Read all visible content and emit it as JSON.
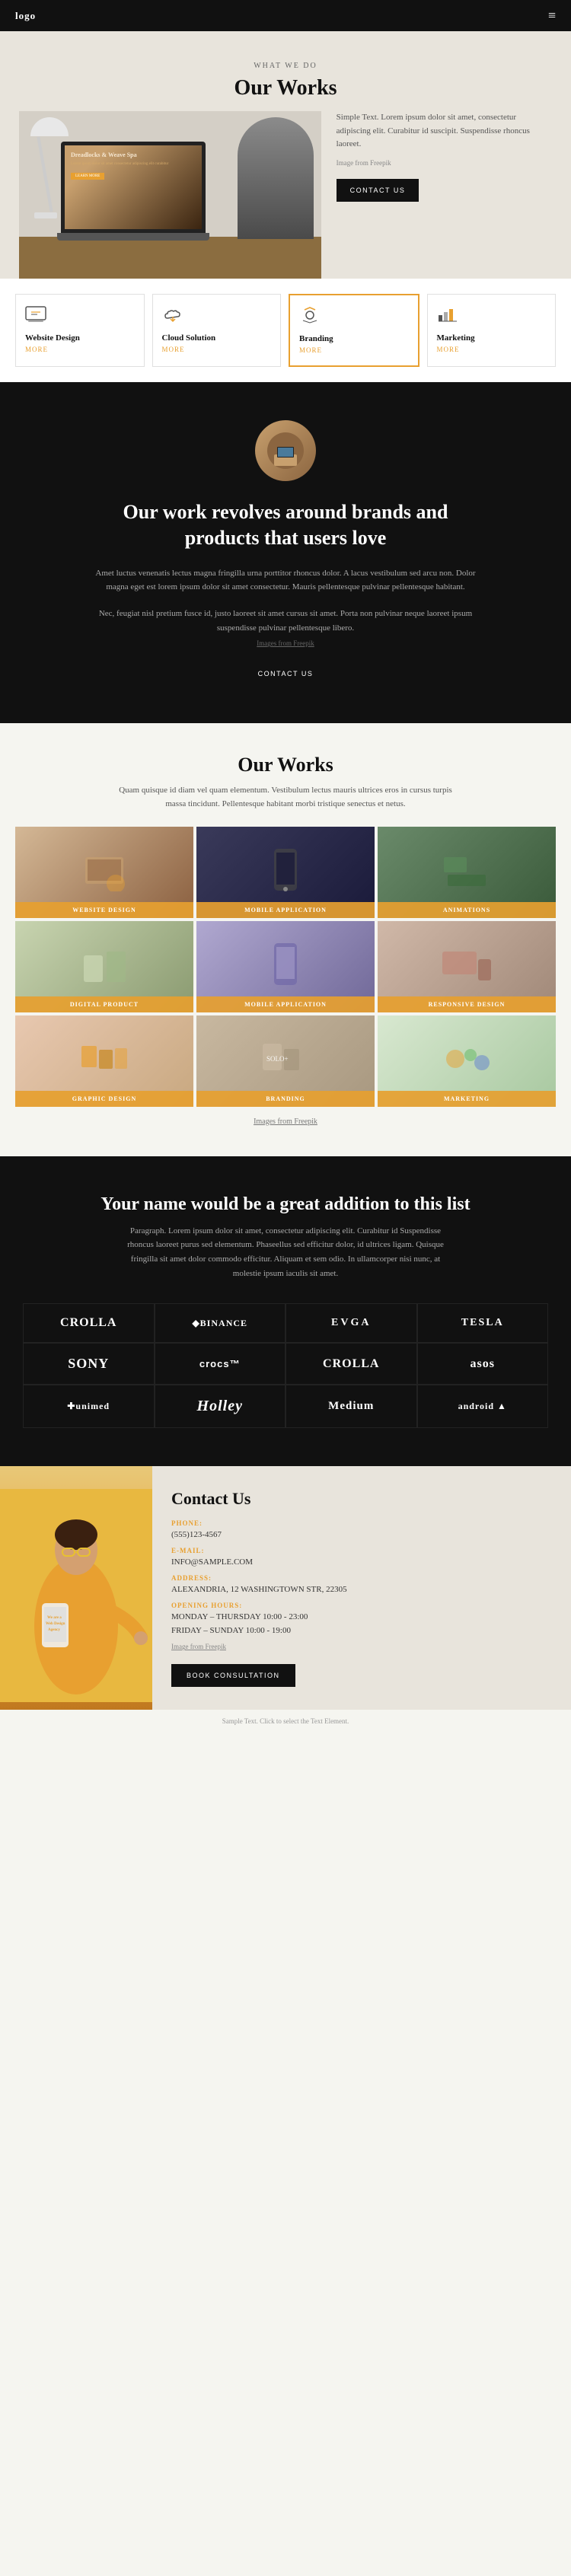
{
  "nav": {
    "logo": "logo",
    "hamburger": "≡"
  },
  "hero": {
    "what_we_do": "WHAT WE DO",
    "title": "Our Works",
    "description": "Simple Text. Lorem ipsum dolor sit amet, consectetur adipiscing elit. Curabitur id suscipit. Suspendisse rhoncus laoreet.",
    "image_credit": "Image from Freepik",
    "contact_button": "CONTACT US",
    "laptop_title": "Dreadlocks & Weave Spa",
    "laptop_sub": "Lorem ipsum dolor sit amet consectetur adipiscing elit curabitur",
    "laptop_btn": "LEARN MORE"
  },
  "services": [
    {
      "icon": "⬜",
      "title": "Website Design",
      "more": "MORE"
    },
    {
      "icon": "☁",
      "title": "Cloud Solution",
      "more": "MORE"
    },
    {
      "icon": "📢",
      "title": "Branding",
      "more": "MORE",
      "highlight": true
    },
    {
      "icon": "📊",
      "title": "Marketing",
      "more": "MORE"
    }
  ],
  "brand_section": {
    "title": "Our work revolves around brands and products that users love",
    "description": "Amet luctus venenatis lectus magna fringilla urna porttitor rhoncus dolor. A lacus vestibulum sed arcu non. Dolor magna eget est lorem ipsum dolor sit amet consectetur. Mauris pellentesque pulvinar pellentesque habitant.",
    "description2": "Nec, feugiat nisl pretium fusce id, justo laoreet sit amet cursus sit amet. Porta non pulvinar neque laoreet ipsum suspendisse pulvinar pellentesque libero.",
    "image_credit": "Images from Freepik",
    "contact_button": "CONTACT US"
  },
  "portfolio": {
    "title": "Our Works",
    "description": "Quam quisque id diam vel quam elementum. Vestibulum lectus mauris ultrices eros in cursus turpis massa tincidunt. Pellentesque habitant morbi tristique senectus et netus.",
    "items": [
      {
        "label": "WEBSITE DESIGN",
        "bg": "port-bg-1"
      },
      {
        "label": "MOBILE APPLICATION",
        "bg": "port-bg-2"
      },
      {
        "label": "ANIMATIONS",
        "bg": "port-bg-3"
      },
      {
        "label": "DIGITAL PRODUCT",
        "bg": "port-bg-4"
      },
      {
        "label": "MOBILE APPLICATION",
        "bg": "port-bg-5"
      },
      {
        "label": "RESPONSIVE DESIGN",
        "bg": "port-bg-6"
      },
      {
        "label": "GRAPHIC DESIGN",
        "bg": "port-bg-7"
      },
      {
        "label": "BRANDING",
        "bg": "port-bg-8"
      },
      {
        "label": "MARKETING",
        "bg": "port-bg-9"
      }
    ],
    "image_credit": "Images from Freepik"
  },
  "clients": {
    "title": "Your name would be a great addition to this list",
    "description": "Paragraph. Lorem ipsum dolor sit amet, consectetur adipiscing elit. Curabitur id Suspendisse rhoncus laoreet purus sed elementum. Phaseellus sed efficitur dolor, id ultrices ligam. Quisque fringilla sit amet dolor commodo efficitur. Aliquam et sem odio. In ullamcorper nisi nunc, at molestie ipsum iaculis sit amet.",
    "logos": [
      {
        "text": "CROLLA",
        "class": "logo-crolla"
      },
      {
        "text": "◆BINANCE",
        "class": "logo-binance"
      },
      {
        "text": "EVGA",
        "class": "logo-evga"
      },
      {
        "text": "TESLA",
        "class": "logo-tesla"
      },
      {
        "text": "SONY",
        "class": "logo-sony"
      },
      {
        "text": "crocs™",
        "class": "logo-crocs"
      },
      {
        "text": "CROLLA",
        "class": "logo-crolla2"
      },
      {
        "text": "asos",
        "class": "logo-asos"
      },
      {
        "text": "✚unimed",
        "class": "logo-unimed"
      },
      {
        "text": "Holley",
        "class": "logo-holley"
      },
      {
        "text": "Medium",
        "class": "logo-medium"
      },
      {
        "text": "android ▲",
        "class": "logo-android"
      }
    ]
  },
  "contact": {
    "title": "Contact Us",
    "phone_label": "PHONE:",
    "phone_value": "(555)123-4567",
    "email_label": "E-MAIL:",
    "email_value": "INFO@SAMPLE.COM",
    "address_label": "ADDRESS:",
    "address_value": "ALEXANDRIA, 12 WASHINGTOWN STR, 22305",
    "hours_label": "OPENING HOURS:",
    "hours_mon_thu": "MONDAY – THURSDAY 10:00 - 23:00",
    "hours_fri_sun": "FRIDAY – SUNDAY 10:00 - 19:00",
    "image_credit": "Image from Freepik",
    "phone_screen_title": "We are a Web Design Agency",
    "cta_button": "BOOK CONSULTATION"
  },
  "footer": {
    "note": "Sample Text. Click to select the Text Element."
  }
}
